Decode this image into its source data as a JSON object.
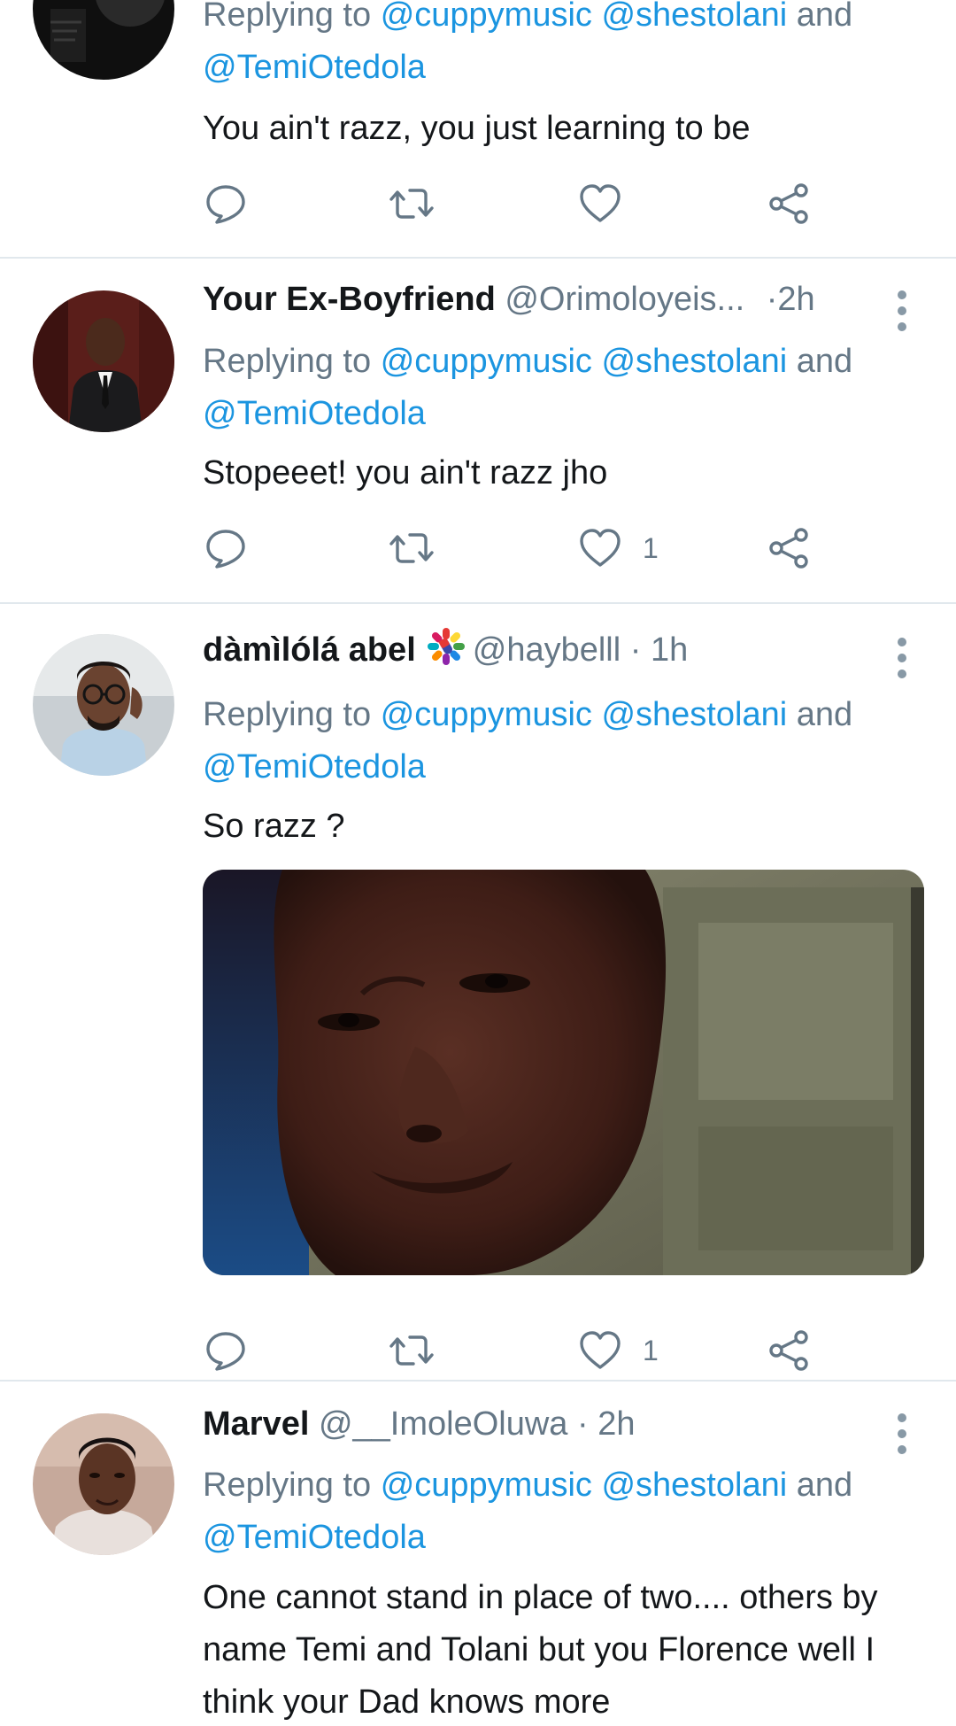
{
  "reply_prefix": "Replying to",
  "tweets": [
    {
      "name": "",
      "handle": "",
      "time": "",
      "mentions": [
        "@cuppymusic",
        "@shestolani",
        "@TemiOtedola"
      ],
      "and_word": "and",
      "text": "You ain't razz, you just learning to be",
      "like_count": ""
    },
    {
      "name": "Your Ex-Boyfriend",
      "handle": "@Orimoloyeis...",
      "dot": "·",
      "time": "2h",
      "mentions": [
        "@cuppymusic",
        "@shestolani",
        "@TemiOtedola"
      ],
      "and_word": "and",
      "text": "Stopeeet! you ain't razz jho",
      "like_count": "1"
    },
    {
      "name": "dàmìlólá abel",
      "badge_icon": "colorful-pills-emoji-icon",
      "handle": "@haybelll",
      "dot": "·",
      "time": "1h",
      "mentions": [
        "@cuppymusic",
        "@shestolani",
        "@TemiOtedola"
      ],
      "and_word": "and",
      "text": "So razz ?",
      "media_icon": "face-photo",
      "like_count": "1"
    },
    {
      "name": "Marvel",
      "handle": "@__ImoleOluwa",
      "dot": "·",
      "time": "2h",
      "mentions": [
        "@cuppymusic",
        "@shestolani",
        "@TemiOtedola"
      ],
      "and_word": "and",
      "text": "One cannot stand in place of two.... others by name Temi and Tolani but you Florence well I think your Dad knows more"
    }
  ],
  "icons": {
    "reply": "speech-bubble-icon",
    "retweet": "retweet-icon",
    "like": "heart-icon",
    "share": "share-icon",
    "more": "vertical-dots-icon"
  },
  "colors": {
    "mention": "#1b95e0",
    "secondary_text": "#657786",
    "primary_text": "#14171a",
    "divider": "#e1e8ed"
  }
}
